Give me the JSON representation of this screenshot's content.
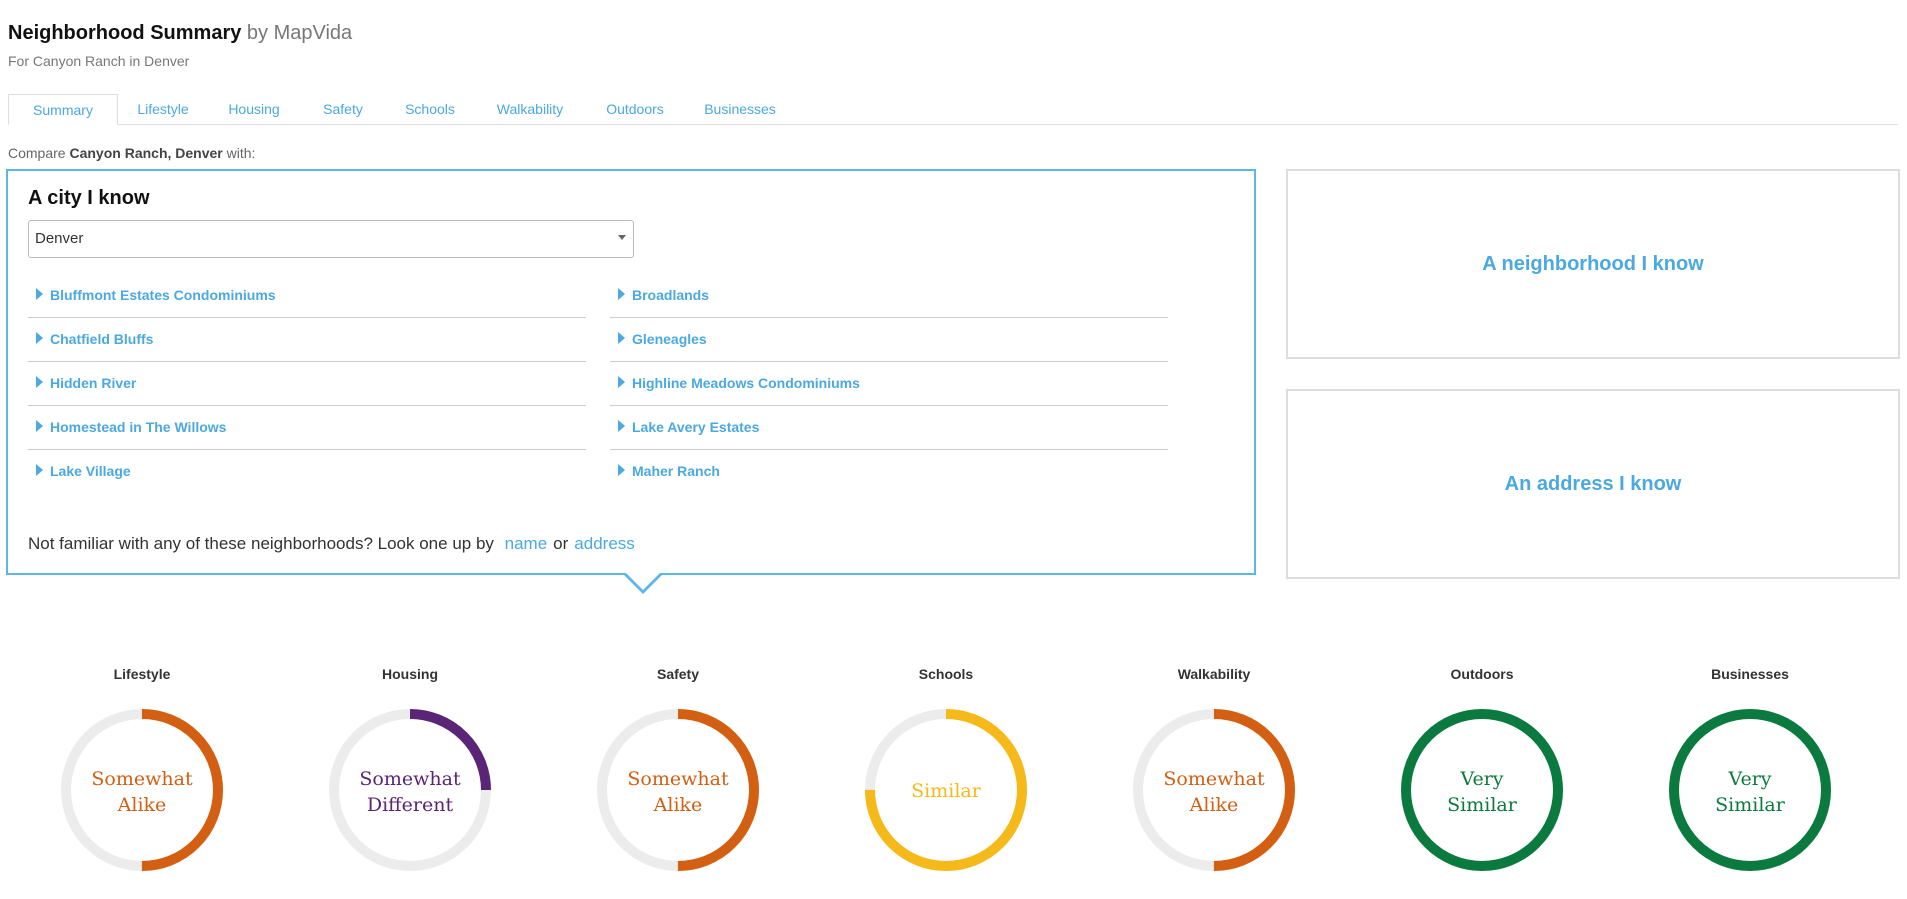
{
  "header": {
    "title": "Neighborhood Summary",
    "by": "by MapVida",
    "subtitle": "For Canyon Ranch in Denver"
  },
  "tabs": [
    {
      "label": "Summary",
      "active": true
    },
    {
      "label": "Lifestyle"
    },
    {
      "label": "Housing"
    },
    {
      "label": "Safety"
    },
    {
      "label": "Schools"
    },
    {
      "label": "Walkability"
    },
    {
      "label": "Outdoors"
    },
    {
      "label": "Businesses"
    }
  ],
  "compare": {
    "prefix": "Compare",
    "place": "Canyon Ranch, Denver",
    "suffix": "with:"
  },
  "city_panel": {
    "heading": "A city I know",
    "selected_city": "Denver",
    "neighborhoods": [
      "Bluffmont Estates Condominiums",
      "Broadlands",
      "Chatfield Bluffs",
      "Gleneagles",
      "Hidden River",
      "Highline Meadows Condominiums",
      "Homestead in The Willows",
      "Lake Avery Estates",
      "Lake Village",
      "Maher Ranch"
    ],
    "lookup_text": "Not familiar with any of these neighborhoods? Look one up by",
    "lookup_name": "name",
    "lookup_or": "or",
    "lookup_address": "address"
  },
  "side_panels": {
    "neighborhood": "A neighborhood I know",
    "address": "An address I know"
  },
  "gauges": [
    {
      "label": "Lifestyle",
      "line1": "Somewhat",
      "line2": "Alike",
      "color": "#d35f12",
      "fraction": 0.5
    },
    {
      "label": "Housing",
      "line1": "Somewhat",
      "line2": "Different",
      "color": "#5b2577",
      "fraction": 0.25
    },
    {
      "label": "Safety",
      "line1": "Somewhat",
      "line2": "Alike",
      "color": "#d35f12",
      "fraction": 0.5
    },
    {
      "label": "Schools",
      "line1": "Similar",
      "line2": "",
      "color": "#f6b91a",
      "fraction": 0.75
    },
    {
      "label": "Walkability",
      "line1": "Somewhat",
      "line2": "Alike",
      "color": "#d35f12",
      "fraction": 0.5
    },
    {
      "label": "Outdoors",
      "line1": "Very",
      "line2": "Similar",
      "color": "#0a7a3e",
      "fraction": 1.0
    },
    {
      "label": "Businesses",
      "line1": "Very",
      "line2": "Similar",
      "color": "#0a7a3e",
      "fraction": 1.0
    }
  ],
  "colors": {
    "accent": "#4aa9e0",
    "panel_border": "#5bb7e6",
    "track": "#ececec"
  }
}
